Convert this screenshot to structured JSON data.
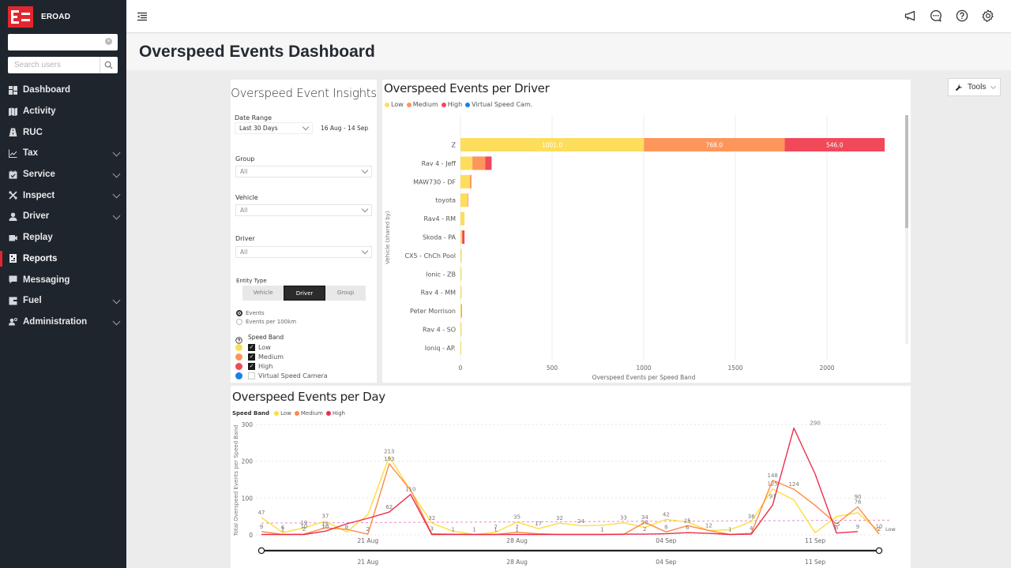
{
  "app": {
    "brand": "EROAD",
    "search_top_value": "",
    "search_users_placeholder": "Search users"
  },
  "sidebar": {
    "items": [
      {
        "label": "Dashboard",
        "icon": "dashboard-icon",
        "expandable": false,
        "active": false
      },
      {
        "label": "Activity",
        "icon": "map-icon",
        "expandable": false,
        "active": false
      },
      {
        "label": "RUC",
        "icon": "road-icon",
        "expandable": false,
        "active": false
      },
      {
        "label": "Tax",
        "icon": "chart-line-icon",
        "expandable": true,
        "active": false
      },
      {
        "label": "Service",
        "icon": "calendar-check-icon",
        "expandable": true,
        "active": false
      },
      {
        "label": "Inspect",
        "icon": "tools-icon",
        "expandable": true,
        "active": false
      },
      {
        "label": "Driver",
        "icon": "user-icon",
        "expandable": true,
        "active": false
      },
      {
        "label": "Replay",
        "icon": "video-icon",
        "expandable": false,
        "active": false
      },
      {
        "label": "Reports",
        "icon": "report-icon",
        "expandable": false,
        "active": true
      },
      {
        "label": "Messaging",
        "icon": "message-icon",
        "expandable": false,
        "active": false
      },
      {
        "label": "Fuel",
        "icon": "fuel-card-icon",
        "expandable": true,
        "active": false
      },
      {
        "label": "Administration",
        "icon": "admin-user-icon",
        "expandable": true,
        "active": false
      }
    ],
    "accent": "#e3262e"
  },
  "topbar": {
    "icons": [
      "megaphone-icon",
      "chat-icon",
      "help-icon",
      "gear-icon"
    ]
  },
  "page": {
    "title": "Overspeed Events Dashboard",
    "tools_label": "Tools"
  },
  "insights": {
    "title": "Overspeed Event Insights",
    "date_range_label": "Date Range",
    "date_range_value": "Last 30 Days",
    "date_range_text": "16 Aug - 14 Sep",
    "group_label": "Group",
    "group_value": "All",
    "vehicle_label": "Vehicle",
    "vehicle_value": "All",
    "driver_label": "Driver",
    "driver_value": "All",
    "entity_type_label": "Entity Type",
    "entity_types": [
      "Vehicle",
      "Driver",
      "Group"
    ],
    "entity_selected": "Driver",
    "metric_options": [
      "Events",
      "Events per 100km"
    ],
    "metric_selected": "Events",
    "speed_band_label": "Speed Band",
    "speed_bands": [
      {
        "label": "Low",
        "color": "#fddd5c",
        "checked": true
      },
      {
        "label": "Medium",
        "color": "#fd965a",
        "checked": true
      },
      {
        "label": "High",
        "color": "#f1495a",
        "checked": true
      },
      {
        "label": "Virtual Speed Camera",
        "color": "#1a7fe8",
        "checked": false
      }
    ]
  },
  "chart_data": [
    {
      "type": "bar",
      "orientation": "horizontal-stacked",
      "title": "Overspeed Events per Driver",
      "xlabel": "Overspeed Events per Speed Band",
      "ylabel": "Vehicle (shared by)",
      "xlim": [
        0,
        2300
      ],
      "xticks": [
        0,
        500,
        1000,
        1500,
        2000
      ],
      "grid": true,
      "legend": [
        "Low",
        "Medium",
        "High",
        "Virtual Speed Cam."
      ],
      "legend_colors": [
        "#fddd5c",
        "#fd965a",
        "#f1495a",
        "#1a7fe8"
      ],
      "legend_position": "top-left",
      "categories": [
        "Z",
        "Rav 4 - Jeff",
        "MAW730 - DF",
        "toyota",
        "Rav4 - RM",
        "Skoda - PA",
        "CX5 - ChCh Pool",
        "Ionic - ZB",
        "Rav 4 - MM",
        "Peter Morrison",
        "Rav 4 - SO",
        "Ioniq - AP."
      ],
      "series": [
        {
          "name": "Low",
          "values": [
            1001,
            65,
            52,
            38,
            22,
            8,
            7,
            6,
            6,
            4,
            6,
            5
          ]
        },
        {
          "name": "Medium",
          "values": [
            768,
            70,
            8,
            3,
            0,
            2,
            0,
            0,
            0,
            2,
            0,
            0
          ]
        },
        {
          "name": "High",
          "values": [
            546,
            35,
            0,
            0,
            0,
            12,
            0,
            0,
            0,
            0,
            0,
            0
          ]
        },
        {
          "name": "Virtual Speed Cam.",
          "values": [
            0,
            0,
            0,
            0,
            0,
            0,
            0,
            0,
            0,
            0,
            0,
            0
          ]
        }
      ],
      "data_labels": {
        "Z": [
          "1001.0",
          "768.0",
          "546.0"
        ]
      }
    },
    {
      "type": "line",
      "title": "Overspeed Events per Day",
      "xlabel": "",
      "ylabel": "Total Overspeed Events per Speed Band",
      "ylim": [
        0,
        300
      ],
      "yticks": [
        0,
        100,
        200,
        300
      ],
      "xtick_labels": [
        "21 Aug",
        "28 Aug",
        "04 Sep",
        "11 Sep"
      ],
      "legend_title": "Speed Band",
      "legend": [
        "Low",
        "Medium",
        "High"
      ],
      "legend_position": "top-left",
      "x": [
        "16 Aug",
        "17 Aug",
        "18 Aug",
        "19 Aug",
        "20 Aug",
        "21 Aug",
        "22 Aug",
        "23 Aug",
        "24 Aug",
        "25 Aug",
        "26 Aug",
        "27 Aug",
        "28 Aug",
        "29 Aug",
        "30 Aug",
        "31 Aug",
        "01 Sep",
        "02 Sep",
        "03 Sep",
        "04 Sep",
        "05 Sep",
        "06 Sep",
        "07 Sep",
        "08 Sep",
        "09 Sep",
        "10 Sep",
        "11 Sep",
        "12 Sep",
        "13 Sep",
        "14 Sep"
      ],
      "series": [
        {
          "name": "Low",
          "color": "#fddd3c",
          "values": [
            47,
            6,
            19,
            37,
            8,
            55,
            213,
            120,
            32,
            10,
            1,
            7,
            35,
            17,
            32,
            25,
            26,
            33,
            20,
            42,
            35,
            12,
            14,
            36,
            125,
            95,
            6,
            50,
            60,
            10
          ]
        },
        {
          "name": "Medium",
          "color": "#fd8a45",
          "values": [
            9,
            1,
            2,
            19,
            15,
            2,
            193,
            122,
            3,
            2,
            1,
            1,
            7,
            3,
            1,
            1,
            1,
            1,
            34,
            8,
            25,
            12,
            1,
            4,
            148,
            124,
            80,
            30,
            76,
            2
          ]
        },
        {
          "name": "High",
          "color": "#ee2c4a",
          "values": [
            1,
            1,
            1,
            10,
            30,
            45,
            62,
            110,
            1,
            1,
            1,
            1,
            1,
            1,
            1,
            1,
            1,
            2,
            2,
            3,
            6,
            4,
            1,
            2,
            81,
            290,
            165,
            5,
            9,
            null
          ]
        }
      ],
      "point_labels": [
        {
          "day": "16 Aug",
          "text": "47"
        },
        {
          "day": "16 Aug",
          "text": "9"
        },
        {
          "day": "17 Aug",
          "text": "6"
        },
        {
          "day": "17 Aug",
          "text": "1"
        },
        {
          "day": "18 Aug",
          "text": "19"
        },
        {
          "day": "18 Aug",
          "text": "2"
        },
        {
          "day": "18 Aug",
          "text": "10"
        },
        {
          "day": "19 Aug",
          "text": "37"
        },
        {
          "day": "19 Aug",
          "text": "10"
        },
        {
          "day": "19 Aug",
          "text": "15"
        },
        {
          "day": "20 Aug",
          "text": "8"
        },
        {
          "day": "21 Aug",
          "text": "2"
        },
        {
          "day": "22 Aug",
          "text": "213"
        },
        {
          "day": "22 Aug",
          "text": "193"
        },
        {
          "day": "22 Aug",
          "text": "62"
        },
        {
          "day": "23 Aug",
          "text": "110"
        },
        {
          "day": "24 Aug",
          "text": "32"
        },
        {
          "day": "24 Aug",
          "text": "3"
        },
        {
          "day": "25 Aug",
          "text": "1"
        },
        {
          "day": "26 Aug",
          "text": "1"
        },
        {
          "day": "27 Aug",
          "text": "7"
        },
        {
          "day": "27 Aug",
          "text": "1"
        },
        {
          "day": "28 Aug",
          "text": "35"
        },
        {
          "day": "28 Aug",
          "text": "7"
        },
        {
          "day": "28 Aug",
          "text": "1"
        },
        {
          "day": "29 Aug",
          "text": "17"
        },
        {
          "day": "30 Aug",
          "text": "32"
        },
        {
          "day": "31 Aug",
          "text": "24"
        },
        {
          "day": "01 Sep",
          "text": "1"
        },
        {
          "day": "02 Sep",
          "text": "33"
        },
        {
          "day": "03 Sep",
          "text": "34"
        },
        {
          "day": "03 Sep",
          "text": "20"
        },
        {
          "day": "03 Sep",
          "text": "2"
        },
        {
          "day": "04 Sep",
          "text": "42"
        },
        {
          "day": "04 Sep",
          "text": "8"
        },
        {
          "day": "05 Sep",
          "text": "25"
        },
        {
          "day": "05 Sep",
          "text": "6"
        },
        {
          "day": "06 Sep",
          "text": "12"
        },
        {
          "day": "07 Sep",
          "text": "1"
        },
        {
          "day": "08 Sep",
          "text": "36"
        },
        {
          "day": "08 Sep",
          "text": "4"
        },
        {
          "day": "09 Sep",
          "text": "148"
        },
        {
          "day": "09 Sep",
          "text": "125"
        },
        {
          "day": "09 Sep",
          "text": "91"
        },
        {
          "day": "10 Sep",
          "text": "124"
        },
        {
          "day": "11 Sep",
          "text": "290"
        },
        {
          "day": "12 Sep",
          "text": "6"
        },
        {
          "day": "12 Sep",
          "text": "15"
        },
        {
          "day": "13 Sep",
          "text": "90"
        },
        {
          "day": "13 Sep",
          "text": "76"
        },
        {
          "day": "13 Sep",
          "text": "9"
        },
        {
          "day": "14 Sep",
          "text": "10"
        },
        {
          "day": "14 Sep",
          "text": "2"
        }
      ],
      "reference_line": {
        "label": "Low",
        "value_start": 32,
        "value_end": 40,
        "color": "#e88ad0",
        "style": "dashed"
      },
      "slider_range": [
        "16 Aug",
        "14 Sep"
      ]
    }
  ],
  "visual_header_icons": [
    "help-icon",
    "filter-icon",
    "focus-mode-icon",
    "more-options-icon"
  ]
}
